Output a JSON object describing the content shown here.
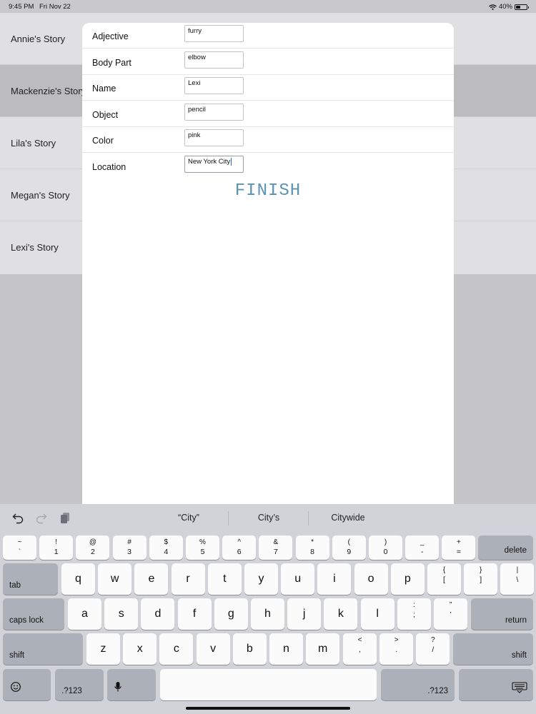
{
  "status_bar": {
    "time": "9:45 PM",
    "date": "Fri Nov 22",
    "battery": "40%",
    "battery_level": 0.4
  },
  "story_list": {
    "items": [
      {
        "label": "Annie's Story"
      },
      {
        "label": "Mackenzie's Story",
        "selected": true
      },
      {
        "label": "Lila's Story"
      },
      {
        "label": "Megan's Story"
      },
      {
        "label": "Lexi's Story"
      }
    ]
  },
  "form": {
    "fields": [
      {
        "label": "Adjective",
        "value": "furry"
      },
      {
        "label": "Body Part",
        "value": "elbow"
      },
      {
        "label": "Name",
        "value": "Lexi"
      },
      {
        "label": "Object",
        "value": "pencil"
      },
      {
        "label": "Color",
        "value": "pink"
      },
      {
        "label": "Location",
        "value": "New York City",
        "focused": true
      }
    ],
    "finish_label": "FINISH",
    "finish_color": "#5b93b3"
  },
  "keyboard": {
    "suggestions": [
      "“City”",
      "City’s",
      "Citywide"
    ],
    "number_row": [
      {
        "top": "~",
        "bot": "`"
      },
      {
        "top": "!",
        "bot": "1"
      },
      {
        "top": "@",
        "bot": "2"
      },
      {
        "top": "#",
        "bot": "3"
      },
      {
        "top": "$",
        "bot": "4"
      },
      {
        "top": "%",
        "bot": "5"
      },
      {
        "top": "^",
        "bot": "6"
      },
      {
        "top": "&",
        "bot": "7"
      },
      {
        "top": "*",
        "bot": "8"
      },
      {
        "top": "(",
        "bot": "9"
      },
      {
        "top": ")",
        "bot": "0"
      },
      {
        "top": "_",
        "bot": "-"
      },
      {
        "top": "+",
        "bot": "="
      }
    ],
    "delete_label": "delete",
    "tab_label": "tab",
    "row_q": [
      "q",
      "w",
      "e",
      "r",
      "t",
      "y",
      "u",
      "i",
      "o",
      "p"
    ],
    "row_q_symbols": [
      {
        "top": "{",
        "bot": "["
      },
      {
        "top": "}",
        "bot": "]"
      },
      {
        "top": "|",
        "bot": "\\"
      }
    ],
    "caps_label": "caps lock",
    "row_a": [
      "a",
      "s",
      "d",
      "f",
      "g",
      "h",
      "j",
      "k",
      "l"
    ],
    "row_a_symbols": [
      {
        "top": ":",
        "bot": ";"
      },
      {
        "top": "”",
        "bot": "’"
      }
    ],
    "return_label": "return",
    "shift_label": "shift",
    "row_z": [
      "z",
      "x",
      "c",
      "v",
      "b",
      "n",
      "m"
    ],
    "row_z_symbols": [
      {
        "top": "<",
        "bot": ","
      },
      {
        "top": ">",
        "bot": "."
      },
      {
        "top": "?",
        "bot": "/"
      }
    ],
    "numbers_label": ".?123",
    "icons": {
      "emoji": "emoji-icon",
      "mic": "microphone-icon",
      "dismiss": "keyboard-dismiss-icon",
      "undo": "undo-icon",
      "redo": "redo-icon",
      "paste": "paste-icon"
    }
  }
}
